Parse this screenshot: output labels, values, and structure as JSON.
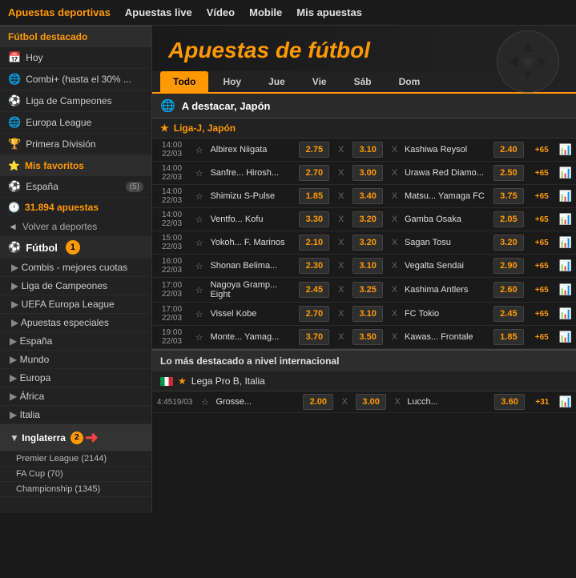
{
  "nav": {
    "items": [
      {
        "label": "Apuestas deportivas",
        "active": true
      },
      {
        "label": "Apuestas live"
      },
      {
        "label": "Vídeo"
      },
      {
        "label": "Mobile"
      },
      {
        "label": "Mis apuestas"
      }
    ]
  },
  "sidebar": {
    "sections": {
      "destacado_title": "Fútbol destacado",
      "items_destacado": [
        {
          "label": "Hoy",
          "icon": "📅"
        },
        {
          "label": "Combi+ (hasta el 30% ...",
          "icon": "🌐"
        },
        {
          "label": "Liga de Campeones",
          "icon": "⚽"
        },
        {
          "label": "Europa League",
          "icon": "🌐"
        },
        {
          "label": "Primera División",
          "icon": "🏆"
        }
      ],
      "favoritos_title": "Mis favoritos",
      "items_favoritos": [
        {
          "label": "España",
          "badge": "(5)"
        }
      ],
      "apuestas_label": "31.894 apuestas",
      "back_label": "Volver a deportes",
      "sport_label": "Fútbol",
      "sport_badge": "1",
      "nav_items": [
        {
          "label": "Combis - mejores cuotas"
        },
        {
          "label": "Liga de Campeones"
        },
        {
          "label": "UEFA Europa League"
        },
        {
          "label": "Apuestas especiales"
        }
      ],
      "regions": [
        {
          "label": "España"
        },
        {
          "label": "Mundo"
        },
        {
          "label": "Europa"
        },
        {
          "label": "África",
          "active": false
        },
        {
          "label": "Italia"
        },
        {
          "label": "Inglaterra",
          "open": true,
          "badge": "2"
        },
        {
          "label": "Premier League (2144)",
          "sub": true
        },
        {
          "label": "FA Cup (70)",
          "sub": true
        },
        {
          "label": "Championship (1345)",
          "sub": true
        }
      ]
    }
  },
  "main": {
    "title": "Apuestas de fútbol",
    "tabs": [
      {
        "label": "Todo",
        "active": true
      },
      {
        "label": "Hoy"
      },
      {
        "label": "Jue"
      },
      {
        "label": "Vie"
      },
      {
        "label": "Sáb"
      },
      {
        "label": "Dom"
      }
    ],
    "section1": {
      "title": "A destacar, Japón",
      "league": "Liga-J, Japón",
      "matches": [
        {
          "time": "14:00",
          "date": "22/03",
          "team1": "Albirex Niigata",
          "odd1": "2.75",
          "x": "X",
          "odd_x": "3.10",
          "team2": "Kashiwa Reysol",
          "odd2": "2.40",
          "more": "+65"
        },
        {
          "time": "14:00",
          "date": "22/03",
          "team1": "Sanfre... Hirosh...",
          "odd1": "2.70",
          "x": "X",
          "odd_x": "3.00",
          "team2": "Urawa Red Diamo...",
          "odd2": "2.50",
          "more": "+65"
        },
        {
          "time": "14:00",
          "date": "22/03",
          "team1": "Shimizu S-Pulse",
          "odd1": "1.85",
          "x": "X",
          "odd_x": "3.40",
          "team2": "Matsu... Yamaga FC",
          "odd2": "3.75",
          "more": "+65"
        },
        {
          "time": "14:00",
          "date": "22/03",
          "team1": "Ventfo... Kofu",
          "odd1": "3.30",
          "x": "X",
          "odd_x": "3.20",
          "team2": "Gamba Osaka",
          "odd2": "2.05",
          "more": "+65"
        },
        {
          "time": "15:00",
          "date": "22/03",
          "team1": "Yokoh... F. Marinos",
          "odd1": "2.10",
          "x": "X",
          "odd_x": "3.20",
          "team2": "Sagan Tosu",
          "odd2": "3.20",
          "more": "+65"
        },
        {
          "time": "16:00",
          "date": "22/03",
          "team1": "Shonan Belima...",
          "odd1": "2.30",
          "x": "X",
          "odd_x": "3.10",
          "team2": "Vegalta Sendai",
          "odd2": "2.90",
          "more": "+65"
        },
        {
          "time": "17:00",
          "date": "22/03",
          "team1": "Nagoya Gramp... Eight",
          "odd1": "2.45",
          "x": "X",
          "odd_x": "3.25",
          "team2": "Kashima Antlers",
          "odd2": "2.60",
          "more": "+65"
        },
        {
          "time": "17:00",
          "date": "22/03",
          "team1": "Vissel Kobe",
          "odd1": "2.70",
          "x": "X",
          "odd_x": "3.10",
          "team2": "FC Tokio",
          "odd2": "2.45",
          "more": "+65"
        },
        {
          "time": "19:00",
          "date": "22/03",
          "team1": "Monte... Yamag...",
          "odd1": "3.70",
          "x": "X",
          "odd_x": "3.50",
          "team2": "Kawas... Frontale",
          "odd2": "1.85",
          "more": "+65"
        }
      ]
    },
    "section2": {
      "title": "Lo más destacado a nivel internacional",
      "league": "Lega Pro B, Italia",
      "matches": [
        {
          "time": "4:4519/03",
          "team1": "Grosse...",
          "odd1": "2.00",
          "x": "X",
          "odd_x": "3.00",
          "team2": "Lucch...",
          "odd2": "3.60",
          "more": "+31"
        }
      ]
    }
  }
}
